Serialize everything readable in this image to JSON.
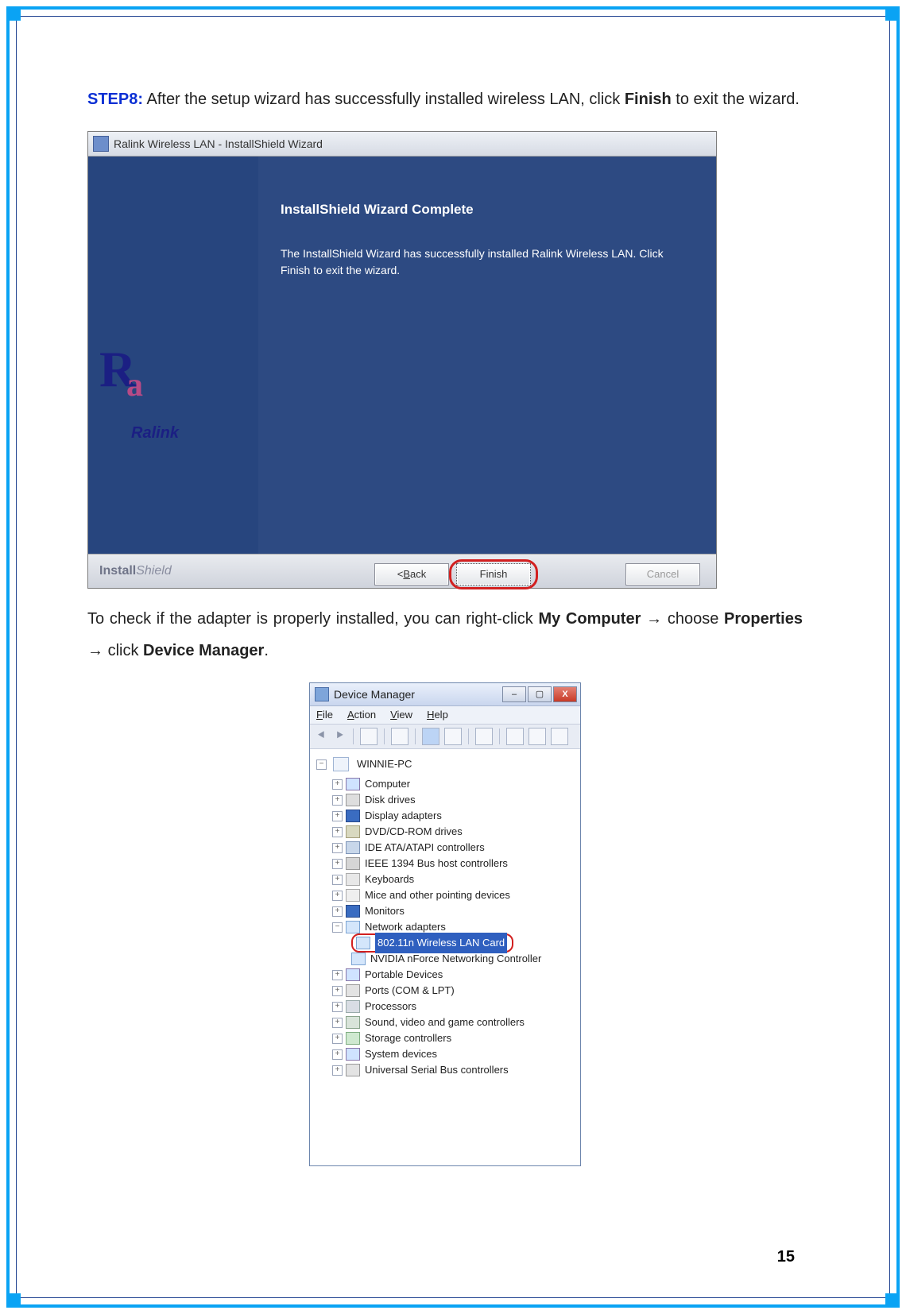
{
  "step": {
    "label": "STEP8:",
    "text_pre": " After the setup wizard has successfully installed wireless LAN, click ",
    "bold1": "Finish",
    "text_post": " to exit the wizard."
  },
  "installer": {
    "title": "Ralink Wireless LAN - InstallShield Wizard",
    "heading": "InstallShield Wizard Complete",
    "body": "The InstallShield Wizard has successfully installed Ralink Wireless LAN.  Click Finish to exit the wizard.",
    "logo_text": "Ralink",
    "footer_brand_bold": "Install",
    "footer_brand_light": "Shield",
    "btn_back_pre": "< ",
    "btn_back_u": "B",
    "btn_back_post": "ack",
    "btn_finish": "Finish",
    "btn_cancel": "Cancel"
  },
  "midtext": {
    "pre": "To check if the adapter is properly installed, you can right-click ",
    "b1": "My Computer",
    "arrow": " → ",
    "mid1": "choose ",
    "b2": "Properties",
    "mid2": " click ",
    "b3": "Device Manager",
    "post": "."
  },
  "devmgr": {
    "title": "Device Manager",
    "menu_file_u": "F",
    "menu_file_r": "ile",
    "menu_action_u": "A",
    "menu_action_r": "ction",
    "menu_view_u": "V",
    "menu_view_r": "iew",
    "menu_help_u": "H",
    "menu_help_r": "elp",
    "close_x": "X",
    "root": "WINNIE-PC",
    "items": {
      "computer": "Computer",
      "disk": "Disk drives",
      "display": "Display adapters",
      "dvd": "DVD/CD-ROM drives",
      "ide": "IDE ATA/ATAPI controllers",
      "ieee": "IEEE 1394 Bus host controllers",
      "kb": "Keyboards",
      "mouse": "Mice and other pointing devices",
      "mon": "Monitors",
      "net": "Network adapters",
      "net_card": "802.11n Wireless LAN Card",
      "net_nvidia": "NVIDIA nForce Networking Controller",
      "portable": "Portable Devices",
      "ports": "Ports (COM & LPT)",
      "proc": "Processors",
      "snd": "Sound, video and game controllers",
      "stor": "Storage controllers",
      "sys": "System devices",
      "usb": "Universal Serial Bus controllers"
    }
  },
  "page_number": "15"
}
